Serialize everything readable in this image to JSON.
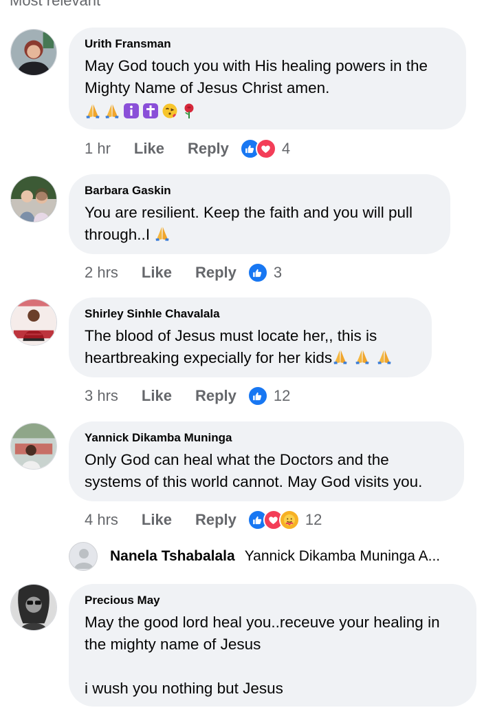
{
  "top_cut_text": "Most relevant",
  "comments": [
    {
      "name": "Urith Fransman",
      "text": "May God touch you with His healing powers in the Mighty Name of Jesus Christ amen.",
      "emojis": [
        "folded-hands",
        "folded-hands",
        "information-symbol",
        "latin-cross",
        "face-blowing-kiss",
        "rose"
      ],
      "time": "1 hr",
      "like_label": "Like",
      "reply_label": "Reply",
      "reactions": [
        "like",
        "love"
      ],
      "reaction_count": "4"
    },
    {
      "name": "Barbara Gaskin",
      "text": "You are resilient. Keep the faith and you will pull through..I",
      "time": "2 hrs",
      "like_label": "Like",
      "reply_label": "Reply",
      "reactions": [
        "like"
      ],
      "reaction_count": "3"
    },
    {
      "name": "Shirley Sinhle Chavalala",
      "text": "The blood of Jesus must locate her,, this is heartbreaking expecially for her kids",
      "time": "3 hrs",
      "like_label": "Like",
      "reply_label": "Reply",
      "reactions": [
        "like"
      ],
      "reaction_count": "12"
    },
    {
      "name": "Yannick Dikamba Muninga",
      "text": "Only God can heal what the Doctors and the systems of this world cannot. May God visits you.",
      "time": "4 hrs",
      "like_label": "Like",
      "reply_label": "Reply",
      "reactions": [
        "like",
        "love",
        "care"
      ],
      "reaction_count": "12"
    },
    {
      "name": "Precious May",
      "text_line1": "May the good lord heal you..receuve your healing in the mighty name of Jesus",
      "text_line2": "i wush you nothing but Jesus"
    }
  ],
  "reply_preview": {
    "name": "Nanela Tshabalala",
    "text": "Yannick Dikamba Muninga A..."
  },
  "colors": {
    "bubble": "#f0f2f5",
    "meta_text": "#65676b",
    "like_blue": "#1877f2",
    "love_red": "#f33e58",
    "care_yellow": "#f7b125"
  }
}
